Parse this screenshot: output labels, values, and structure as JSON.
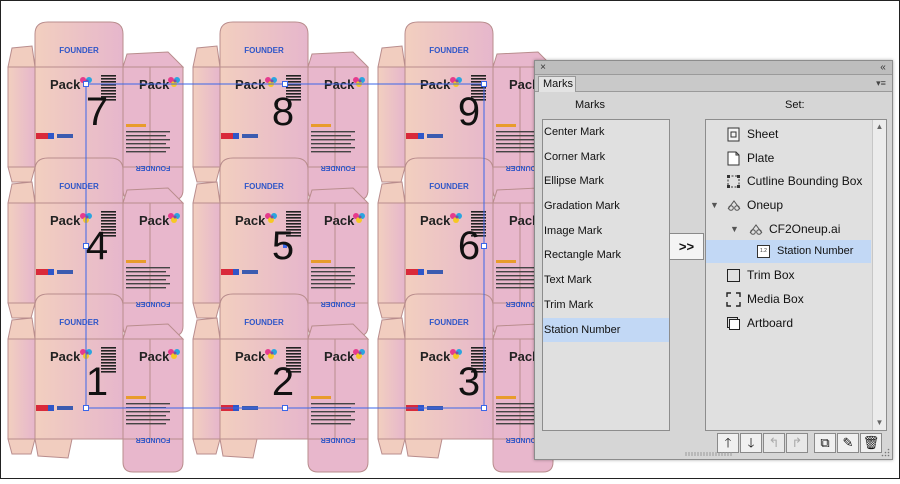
{
  "artwork": {
    "brand_top": "FOUNDER",
    "brand_bottom": "FOUNDER",
    "product_name": "Pack",
    "station_numbers": [
      "7",
      "8",
      "9",
      "4",
      "5",
      "6",
      "1",
      "2",
      "3"
    ],
    "colors": {
      "box_fill": "#eec9c4",
      "box_pink": "#e8b7cc",
      "box_outline": "#b98d8d",
      "selection_blue": "#3b66e8",
      "brand_blue": "#2f56c8"
    }
  },
  "panel": {
    "title": "Marks",
    "close_glyph": "×",
    "collapse_glyph": "«",
    "menu_glyph": "▾≡",
    "marks_heading": "Marks",
    "set_heading": "Set:",
    "add_label": ">>",
    "marks_list": [
      {
        "label": "Center Mark",
        "selected": false
      },
      {
        "label": "Corner Mark",
        "selected": false
      },
      {
        "label": "Ellipse Mark",
        "selected": false
      },
      {
        "label": "Gradation Mark",
        "selected": false
      },
      {
        "label": "Image Mark",
        "selected": false
      },
      {
        "label": "Rectangle Mark",
        "selected": false
      },
      {
        "label": "Text Mark",
        "selected": false
      },
      {
        "label": "Trim Mark",
        "selected": false
      },
      {
        "label": "Station Number",
        "selected": true
      }
    ],
    "set_tree": [
      {
        "label": "Sheet",
        "icon": "sheet-icon",
        "level": 0,
        "expander": "",
        "selected": false
      },
      {
        "label": "Plate",
        "icon": "plate-icon",
        "level": 0,
        "expander": "",
        "selected": false
      },
      {
        "label": "Cutline Bounding Box",
        "icon": "cutline-bounding-box-icon",
        "level": 0,
        "expander": "",
        "selected": false
      },
      {
        "label": "Oneup",
        "icon": "oneup-icon",
        "level": 0,
        "expander": "▼",
        "selected": false
      },
      {
        "label": "CF2Oneup.ai",
        "icon": "oneup-file-icon",
        "level": 1,
        "expander": "▼",
        "selected": false
      },
      {
        "label": "Station Number",
        "icon": "station-number-icon",
        "level": 2,
        "expander": "",
        "selected": true
      },
      {
        "label": "Trim Box",
        "icon": "trim-box-icon",
        "level": 0,
        "expander": "",
        "selected": false
      },
      {
        "label": "Media Box",
        "icon": "media-box-icon",
        "level": 0,
        "expander": "",
        "selected": false
      },
      {
        "label": "Artboard",
        "icon": "artboard-icon",
        "level": 0,
        "expander": "",
        "selected": false
      }
    ],
    "toolbar": [
      {
        "name": "move-up-button",
        "icon": "arrow-up-icon",
        "glyph": "🡑",
        "enabled": true
      },
      {
        "name": "move-down-button",
        "icon": "arrow-down-icon",
        "glyph": "🡓",
        "enabled": true
      },
      {
        "name": "move-out-button",
        "icon": "move-out-icon",
        "glyph": "↰",
        "enabled": false
      },
      {
        "name": "move-in-button",
        "icon": "move-in-icon",
        "glyph": "↱",
        "enabled": false
      },
      {
        "name": "duplicate-button",
        "icon": "duplicate-icon",
        "glyph": "⧉",
        "enabled": true
      },
      {
        "name": "edit-mark-button",
        "icon": "edit-mark-icon",
        "glyph": "✎",
        "enabled": true
      },
      {
        "name": "delete-button",
        "icon": "trash-icon",
        "glyph": "🗑",
        "enabled": true
      }
    ],
    "colors": {
      "panel_bg": "#d6d6d6",
      "list_bg": "#e0e0e0",
      "selection": "#c2d8f5"
    }
  }
}
